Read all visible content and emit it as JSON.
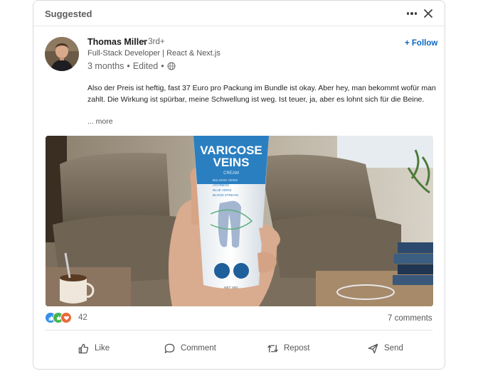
{
  "header": {
    "label": "Suggested",
    "more_icon": "more-horizontal-icon",
    "close_icon": "close-icon"
  },
  "author": {
    "name": "Thomas Miller",
    "degree": "• 3rd+",
    "headline": "Full-Stack Developer | React & Next.js",
    "time": "3 months",
    "separator1": "•",
    "edited": "Edited",
    "separator2": "•",
    "visibility_icon": "globe-icon"
  },
  "follow_label": "+ Follow",
  "post": {
    "text": "Also der Preis ist heftig, fast 37 Euro pro Packung im Bundle ist okay. Aber hey, man bekommt wofür man zahlt. Die Wirkung ist spürbar, meine Schwellung ist weg. Ist teuer, ja, aber es lohnt sich für die Beine.",
    "see_more": "... more"
  },
  "image": {
    "brand_line1": "VARICOSE",
    "brand_line2": "VEINS",
    "sub": "CREAM",
    "bullets": [
      "BULGING VEINS",
      "ACHINESS",
      "BLUE VEINS",
      "BLOOD STREAM"
    ],
    "net": "NET: 60G"
  },
  "social": {
    "reaction_count": "42",
    "comments": "7 comments",
    "reaction_icons": [
      "like-icon",
      "celebrate-icon",
      "love-icon"
    ]
  },
  "actions": [
    {
      "label": "Like",
      "icon": "thumbs-up-icon"
    },
    {
      "label": "Comment",
      "icon": "comment-icon"
    },
    {
      "label": "Repost",
      "icon": "repost-icon"
    },
    {
      "label": "Send",
      "icon": "send-icon"
    }
  ],
  "colors": {
    "link": "#0a66c2",
    "tube_blue": "#2a7fc1",
    "like": "#378fe9",
    "celebrate": "#44b54e",
    "love": "#e96a3a"
  }
}
